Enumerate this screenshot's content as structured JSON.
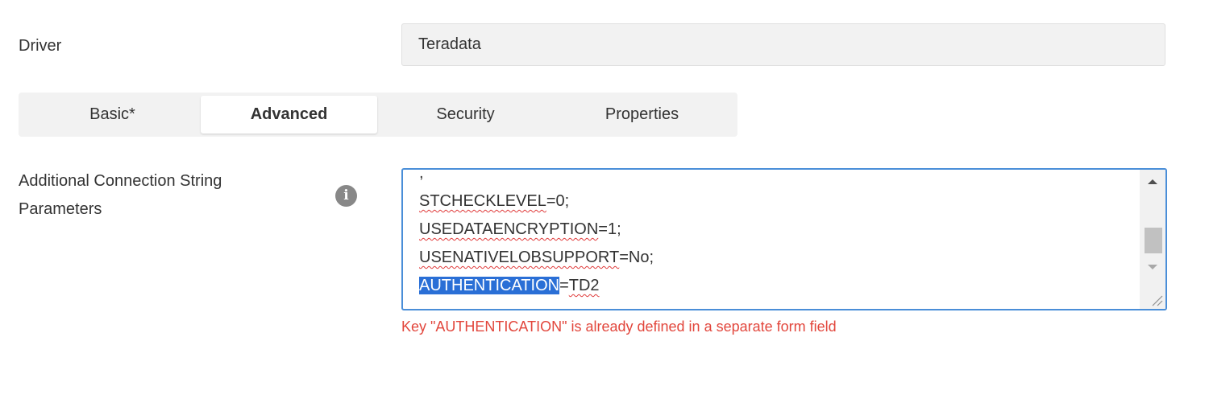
{
  "driver": {
    "label": "Driver",
    "value": "Teradata"
  },
  "tabs": [
    {
      "label": "Basic*",
      "active": false
    },
    {
      "label": "Advanced",
      "active": true
    },
    {
      "label": "Security",
      "active": false
    },
    {
      "label": "Properties",
      "active": false
    }
  ],
  "params": {
    "label": "Additional Connection String Parameters",
    "info_icon": "info-icon",
    "lines": [
      {
        "text": ","
      },
      {
        "key": "STCHECKLEVEL",
        "rest": "=0;"
      },
      {
        "key": "USEDATAENCRYPTION",
        "rest": "=1;"
      },
      {
        "key": "USENATIVELOBSUPPORT",
        "rest": "=No;"
      },
      {
        "key": "AUTHENTICATION",
        "sep": "=",
        "value": "TD2"
      }
    ],
    "error": "Key \"AUTHENTICATION\" is already defined in a separate form field"
  },
  "colors": {
    "accent": "#4a8ed8",
    "selection": "#2a6fd6",
    "error": "#e2463c",
    "tab_bar": "#f2f2f2"
  }
}
